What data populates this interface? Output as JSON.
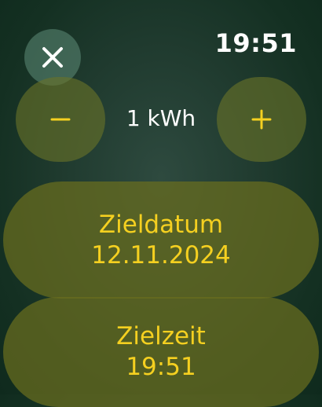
{
  "status": {
    "time": "19:51"
  },
  "controls": {
    "close_icon": "close-icon",
    "minus_icon": "minus-icon",
    "plus_icon": "plus-icon",
    "energy_value": "1 kWh",
    "accent_color": "#f5d020"
  },
  "target_date": {
    "label": "Zieldatum",
    "value": "12.11.2024"
  },
  "target_time": {
    "label": "Zielzeit",
    "value": "19:51"
  }
}
